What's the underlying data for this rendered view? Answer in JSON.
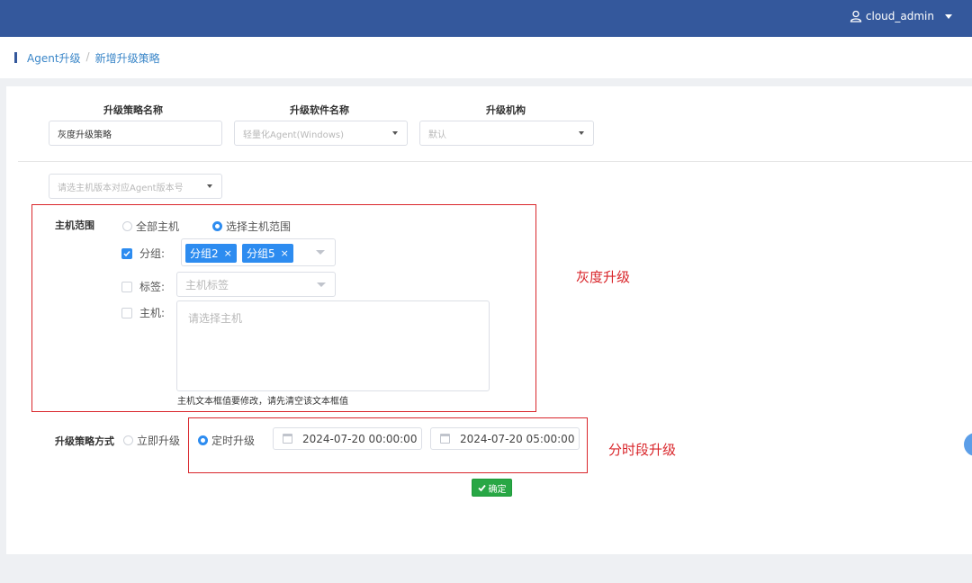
{
  "header": {
    "username": "cloud_admin"
  },
  "breadcrumb": {
    "parent": "Agent升级",
    "separator": "/",
    "current": "新增升级策略"
  },
  "form": {
    "strategy_name_label": "升级策略名称",
    "strategy_name_value": "灰度升级策略",
    "software_name_label": "升级软件名称",
    "software_name_value": "轻量化Agent(Windows)",
    "org_label": "升级机构",
    "org_value": "默认",
    "agent_version_placeholder": "请选主机版本对应Agent版本号",
    "host_scope": {
      "label": "主机范围",
      "option_all": "全部主机",
      "option_select": "选择主机范围",
      "group_label": "分组:",
      "group_tags": [
        "分组2",
        "分组5"
      ],
      "tag_remove": "×",
      "label_label": "标签:",
      "label_placeholder": "主机标签",
      "host_label": "主机:",
      "host_placeholder": "请选择主机",
      "hint": "主机文本框值要修改，请先清空该文本框值"
    },
    "mode": {
      "label": "升级策略方式",
      "option_immediate": "立即升级",
      "option_scheduled": "定时升级",
      "start_time": "2024-07-20 00:00:00",
      "end_time": "2024-07-20 05:00:00"
    },
    "confirm_label": "确定"
  },
  "annotations": {
    "gray_upgrade": "灰度升级",
    "timed_upgrade": "分时段升级"
  },
  "colors": {
    "header": "#34589c",
    "accent": "#2d8cf0",
    "annotation": "#d9262b",
    "confirm": "#28a745"
  }
}
